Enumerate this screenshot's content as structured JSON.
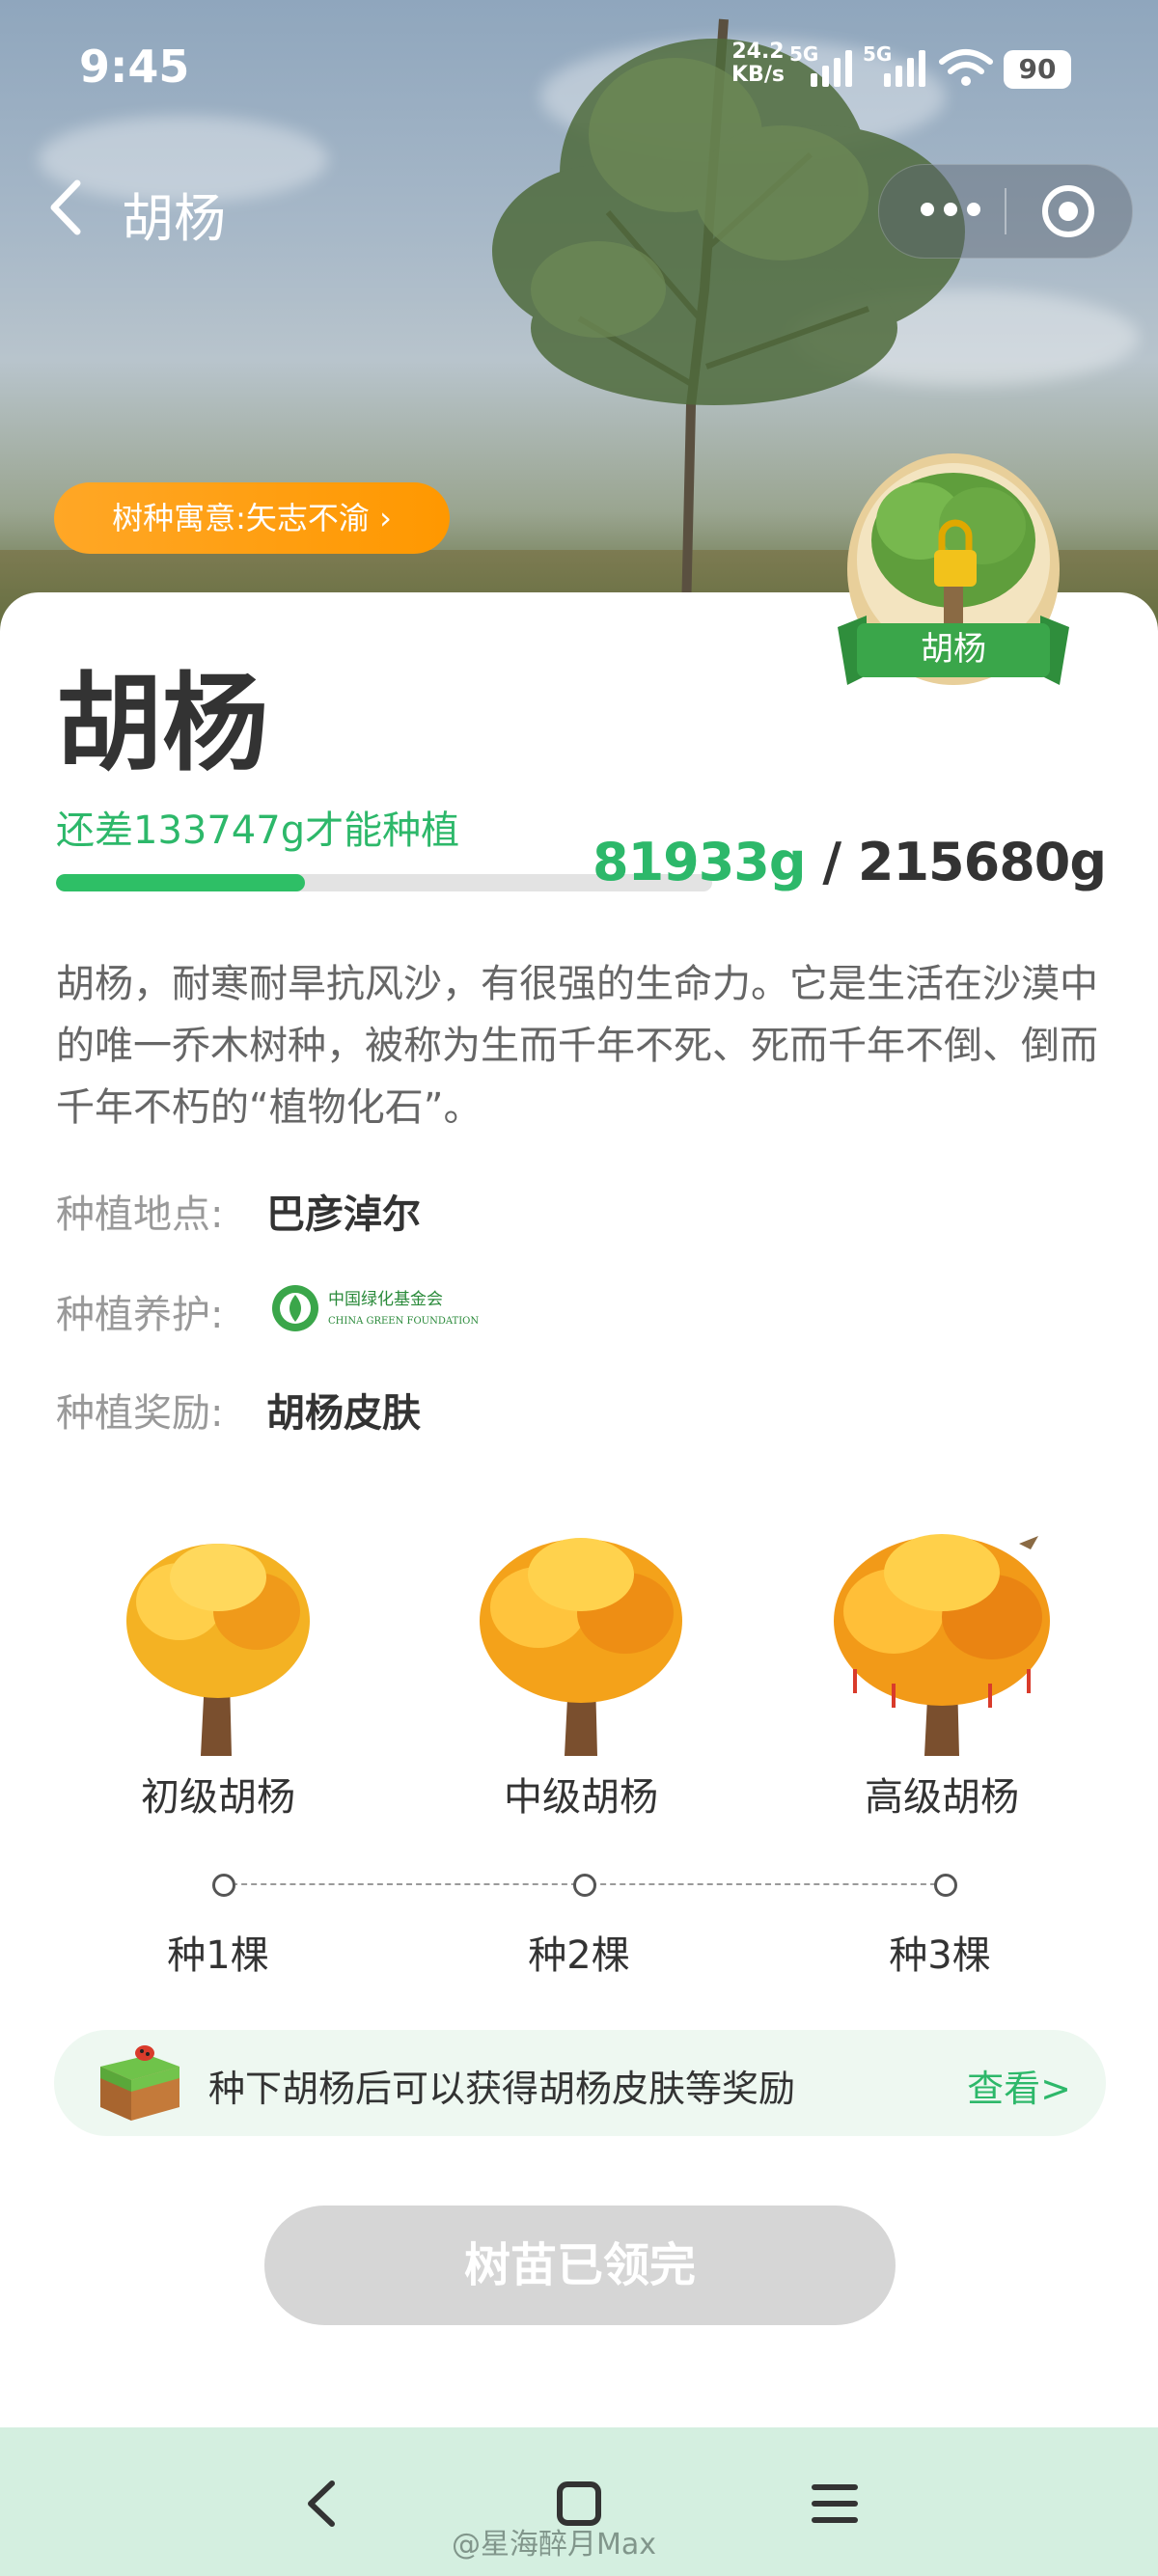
{
  "status_bar": {
    "time": "9:45",
    "speed_value": "24.2",
    "speed_unit": "KB/s",
    "network_1": "5G",
    "network_2": "5G",
    "battery": "90"
  },
  "nav": {
    "title": "胡杨",
    "back_icon": "chevron-left-icon",
    "more_icon": "more-dots-icon",
    "close_icon": "target-circle-icon"
  },
  "hero": {
    "meaning_label": "树种寓意:矢志不渝 ›",
    "badge_label": "胡杨"
  },
  "tree": {
    "name": "胡杨",
    "remaining_text": "还差133747g才能种植",
    "current_weight": "81933g",
    "separator": "/",
    "total_weight": "215680g",
    "progress_fraction": 0.38,
    "description": "胡杨，耐寒耐旱抗风沙，有很强的生命力。它是生活在沙漠中的唯一乔木树种，被称为生而千年不死、死而千年不倒、倒而千年不朽的“植物化石”。"
  },
  "info": {
    "location_label": "种植地点:",
    "location_value": "巴彦淖尔",
    "maintenance_label": "种植养护:",
    "maintenance_logo_cn": "中国绿化基金会",
    "maintenance_logo_en": "CHINA GREEN FOUNDATION",
    "reward_label": "种植奖励:",
    "reward_value": "胡杨皮肤"
  },
  "levels": [
    {
      "name": "初级胡杨",
      "count": "种1棵"
    },
    {
      "name": "中级胡杨",
      "count": "种2棵"
    },
    {
      "name": "高级胡杨",
      "count": "种3棵"
    }
  ],
  "reward_bar": {
    "text": "种下胡杨后可以获得胡杨皮肤等奖励",
    "link": "查看>"
  },
  "claim_button": "树苗已领完",
  "system_nav": {
    "back_icon": "back-triangle-icon",
    "home_icon": "home-square-icon",
    "menu_icon": "menu-lines-icon"
  },
  "watermark": "@星海醉月Max",
  "colors": {
    "accent_green": "#2db86a",
    "pill_orange": "#ff9800",
    "disabled_button": "#d6d6d6",
    "system_bar": "#d4efe0"
  }
}
